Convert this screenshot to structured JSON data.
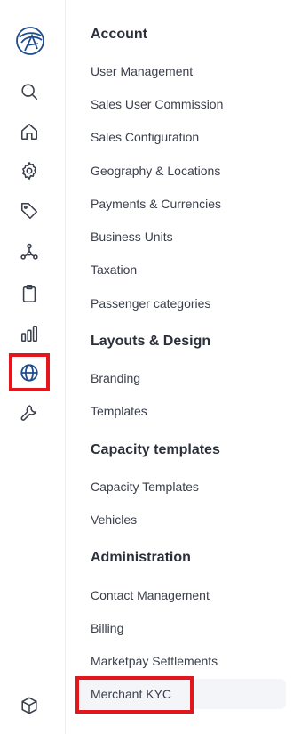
{
  "rail": {
    "icons": [
      {
        "name": "search-icon"
      },
      {
        "name": "home-icon"
      },
      {
        "name": "gear-icon"
      },
      {
        "name": "tag-icon"
      },
      {
        "name": "network-icon"
      },
      {
        "name": "clipboard-icon"
      },
      {
        "name": "bar-chart-icon"
      },
      {
        "name": "globe-icon",
        "active": true
      },
      {
        "name": "wrench-icon"
      },
      {
        "name": "cube-icon"
      }
    ],
    "highlight_color": "#e3161b",
    "accent_color": "#1f4d8c"
  },
  "menu": {
    "sections": [
      {
        "title": "Account",
        "items": [
          "User Management",
          "Sales User Commission",
          "Sales Configuration",
          "Geography & Locations",
          "Payments & Currencies",
          "Business Units",
          "Taxation",
          "Passenger categories"
        ]
      },
      {
        "title": "Layouts & Design",
        "items": [
          "Branding",
          "Templates"
        ]
      },
      {
        "title": "Capacity templates",
        "items": [
          "Capacity Templates",
          "Vehicles"
        ]
      },
      {
        "title": "Administration",
        "items": [
          "Contact Management",
          "Billing",
          "Marketpay Settlements",
          "Merchant KYC"
        ]
      }
    ],
    "selected_item": "Merchant KYC"
  }
}
